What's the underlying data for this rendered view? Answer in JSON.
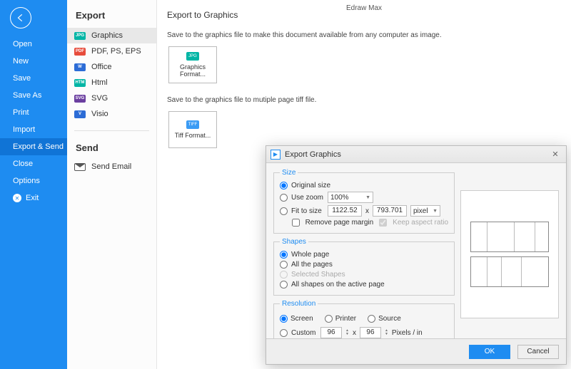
{
  "app": {
    "title": "Edraw Max"
  },
  "sidebar": {
    "items": [
      {
        "label": "Open"
      },
      {
        "label": "New"
      },
      {
        "label": "Save"
      },
      {
        "label": "Save As"
      },
      {
        "label": "Print"
      },
      {
        "label": "Import"
      },
      {
        "label": "Export & Send"
      },
      {
        "label": "Close"
      },
      {
        "label": "Options"
      }
    ],
    "exit_label": "Exit"
  },
  "panel": {
    "export_title": "Export",
    "formats": [
      {
        "label": "Graphics",
        "tag": "JPG",
        "color": "#00b5a5"
      },
      {
        "label": "PDF, PS, EPS",
        "tag": "PDF",
        "color": "#e74c3c"
      },
      {
        "label": "Office",
        "tag": "W",
        "color": "#2c6cd6"
      },
      {
        "label": "Html",
        "tag": "HTM",
        "color": "#00b5a5"
      },
      {
        "label": "SVG",
        "tag": "SVG",
        "color": "#6b3fa0"
      },
      {
        "label": "Visio",
        "tag": "V",
        "color": "#2c6cd6"
      }
    ],
    "send_title": "Send",
    "send_email_label": "Send Email"
  },
  "main": {
    "title": "Export to Graphics",
    "desc1": "Save to the graphics file to make this document available from any computer as image.",
    "desc2": "Save to the graphics file to mutiple page tiff file.",
    "tile1": {
      "label": "Graphics Format...",
      "tag": "JPG",
      "color": "#00b5a5"
    },
    "tile2": {
      "label": "Tiff Format...",
      "tag": "TIFF",
      "color": "#3a9bf4"
    }
  },
  "dialog": {
    "title": "Export Graphics",
    "size": {
      "legend": "Size",
      "original": "Original size",
      "use_zoom": "Use zoom",
      "zoom_value": "100%",
      "fit_to_size": "Fit to size",
      "width": "1122.52",
      "height": "793.701",
      "x_label": "x",
      "unit": "pixel",
      "remove_margin": "Remove page margin",
      "keep_aspect": "Keep aspect ratio"
    },
    "shapes": {
      "legend": "Shapes",
      "whole_page": "Whole page",
      "all_pages": "All the pages",
      "selected": "Selected Shapes",
      "all_active": "All shapes on the active page"
    },
    "resolution": {
      "legend": "Resolution",
      "screen": "Screen",
      "printer": "Printer",
      "source": "Source",
      "custom": "Custom",
      "val1": "96",
      "val2": "96",
      "x_label": "x",
      "unit": "Pixels / in"
    },
    "ok": "OK",
    "cancel": "Cancel"
  }
}
